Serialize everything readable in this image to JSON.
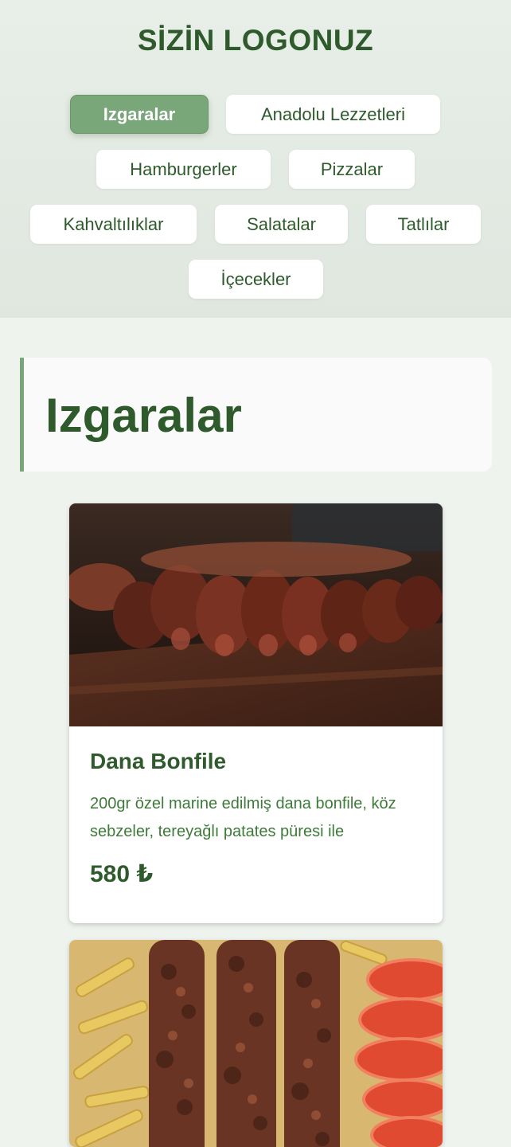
{
  "header": {
    "logo": "SİZİN LOGONUZ",
    "categories": [
      {
        "label": "Izgaralar",
        "active": true
      },
      {
        "label": "Anadolu Lezzetleri",
        "active": false
      },
      {
        "label": "Hamburgerler",
        "active": false
      },
      {
        "label": "Pizzalar",
        "active": false
      },
      {
        "label": "Kahvaltılıklar",
        "active": false
      },
      {
        "label": "Salatalar",
        "active": false
      },
      {
        "label": "Tatlılar",
        "active": false
      },
      {
        "label": "İçecekler",
        "active": false
      }
    ]
  },
  "section": {
    "title": "Izgaralar"
  },
  "items": [
    {
      "name": "Dana Bonfile",
      "description": "200gr özel marine edilmiş dana bonfile, köz sebzeler, tereyağlı patates püresi ile",
      "price": "580 ₺",
      "image_icon": "steak-photo"
    },
    {
      "image_icon": "kebab-skewers-photo"
    }
  ],
  "colors": {
    "brand_green": "#2e5a2c",
    "accent_green": "#7aa77a",
    "background": "#eef3ee"
  }
}
